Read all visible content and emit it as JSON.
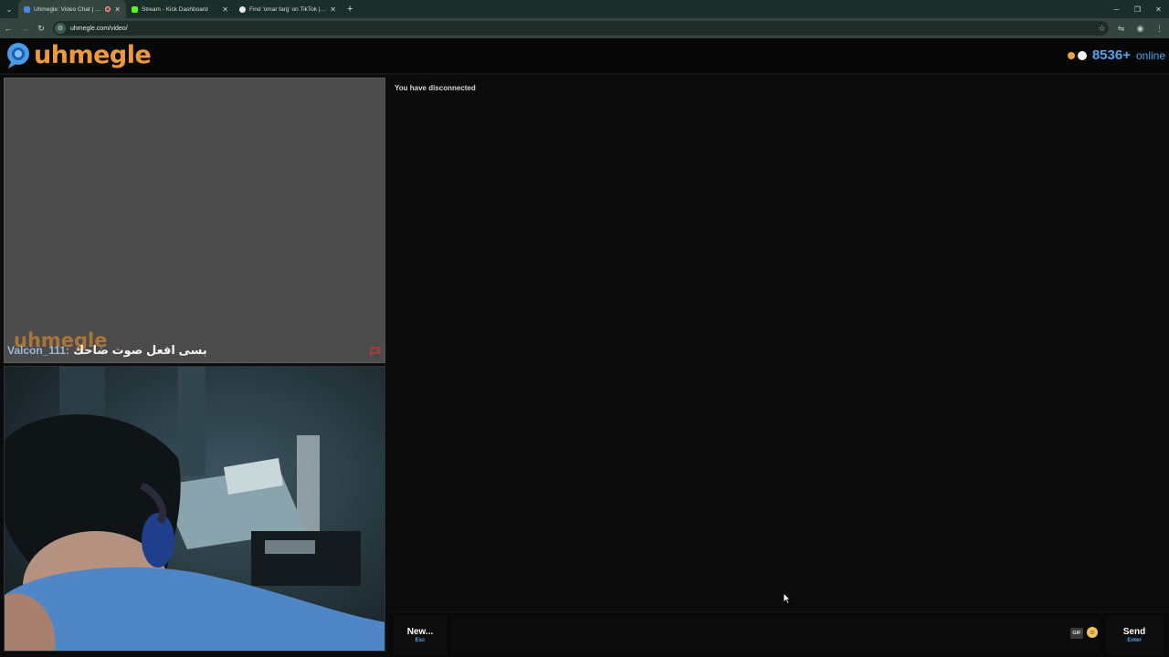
{
  "browser": {
    "tabs": [
      {
        "title": "Uhmegle: Video Chat | On…",
        "active": true,
        "favicon_color": "#4a86e8"
      },
      {
        "title": "Stream - Kick Dashboard",
        "active": false,
        "favicon_color": "#53fc18"
      },
      {
        "title": "Find 'omar farg' on TikTok | Ti…",
        "active": false,
        "favicon_color": "#e8e8e8"
      }
    ],
    "new_tab_icon": "plus-icon",
    "address": "uhmegle.com/video/"
  },
  "site": {
    "logo_text": "uhmegle",
    "online_count": "8536+",
    "online_label": "online"
  },
  "video_top": {
    "watermark": "uhmegle",
    "caption_user": "Valcon_111:",
    "caption_message": "بسى افعل صوت ضاحك"
  },
  "chat": {
    "status": "You have disconnected",
    "input_value": "",
    "new_button": {
      "label": "New...",
      "hint": "Esc"
    },
    "gif_label": "GIF",
    "send_button": {
      "label": "Send",
      "hint": "Enter"
    }
  },
  "colors": {
    "brand_orange": "#f0993a",
    "accent_blue": "#4aa8f0",
    "chrome_bg": "#1b2f2a"
  }
}
